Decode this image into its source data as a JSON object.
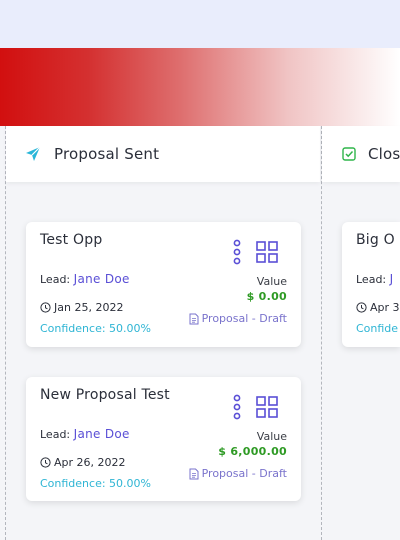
{
  "columns": [
    {
      "title": "Proposal Sent"
    },
    {
      "title": "Clos"
    }
  ],
  "cards": [
    {
      "name": "Test Opp",
      "lead_label": "Lead:",
      "lead_name": "Jane Doe",
      "date": "Jan 25, 2022",
      "confidence": "Confidence: 50.00%",
      "value_label": "Value",
      "value_amount": "$ 0.00",
      "status": "Proposal - Draft"
    },
    {
      "name": "New Proposal Test",
      "lead_label": "Lead:",
      "lead_name": "Jane Doe",
      "date": "Apr 26, 2022",
      "confidence": "Confidence: 50.00%",
      "value_label": "Value",
      "value_amount": "$ 6,000.00",
      "status": "Proposal - Draft"
    },
    {
      "name": "Big O",
      "lead_label": "Lead:",
      "lead_name": "J",
      "date": "Apr 3",
      "confidence": "Confide"
    }
  ],
  "colors": {
    "accent_purple": "#5a4fd6",
    "value_green": "#2e9a24",
    "confidence_cyan": "#2fb5d4",
    "banner_red": "#d20f0f"
  },
  "icons": {
    "proposal_sent": "paper-plane-icon",
    "closed": "checkbox-icon",
    "menu": "vertical-dots-icon",
    "view": "grid-icon",
    "date": "clock-icon",
    "status": "document-icon"
  }
}
